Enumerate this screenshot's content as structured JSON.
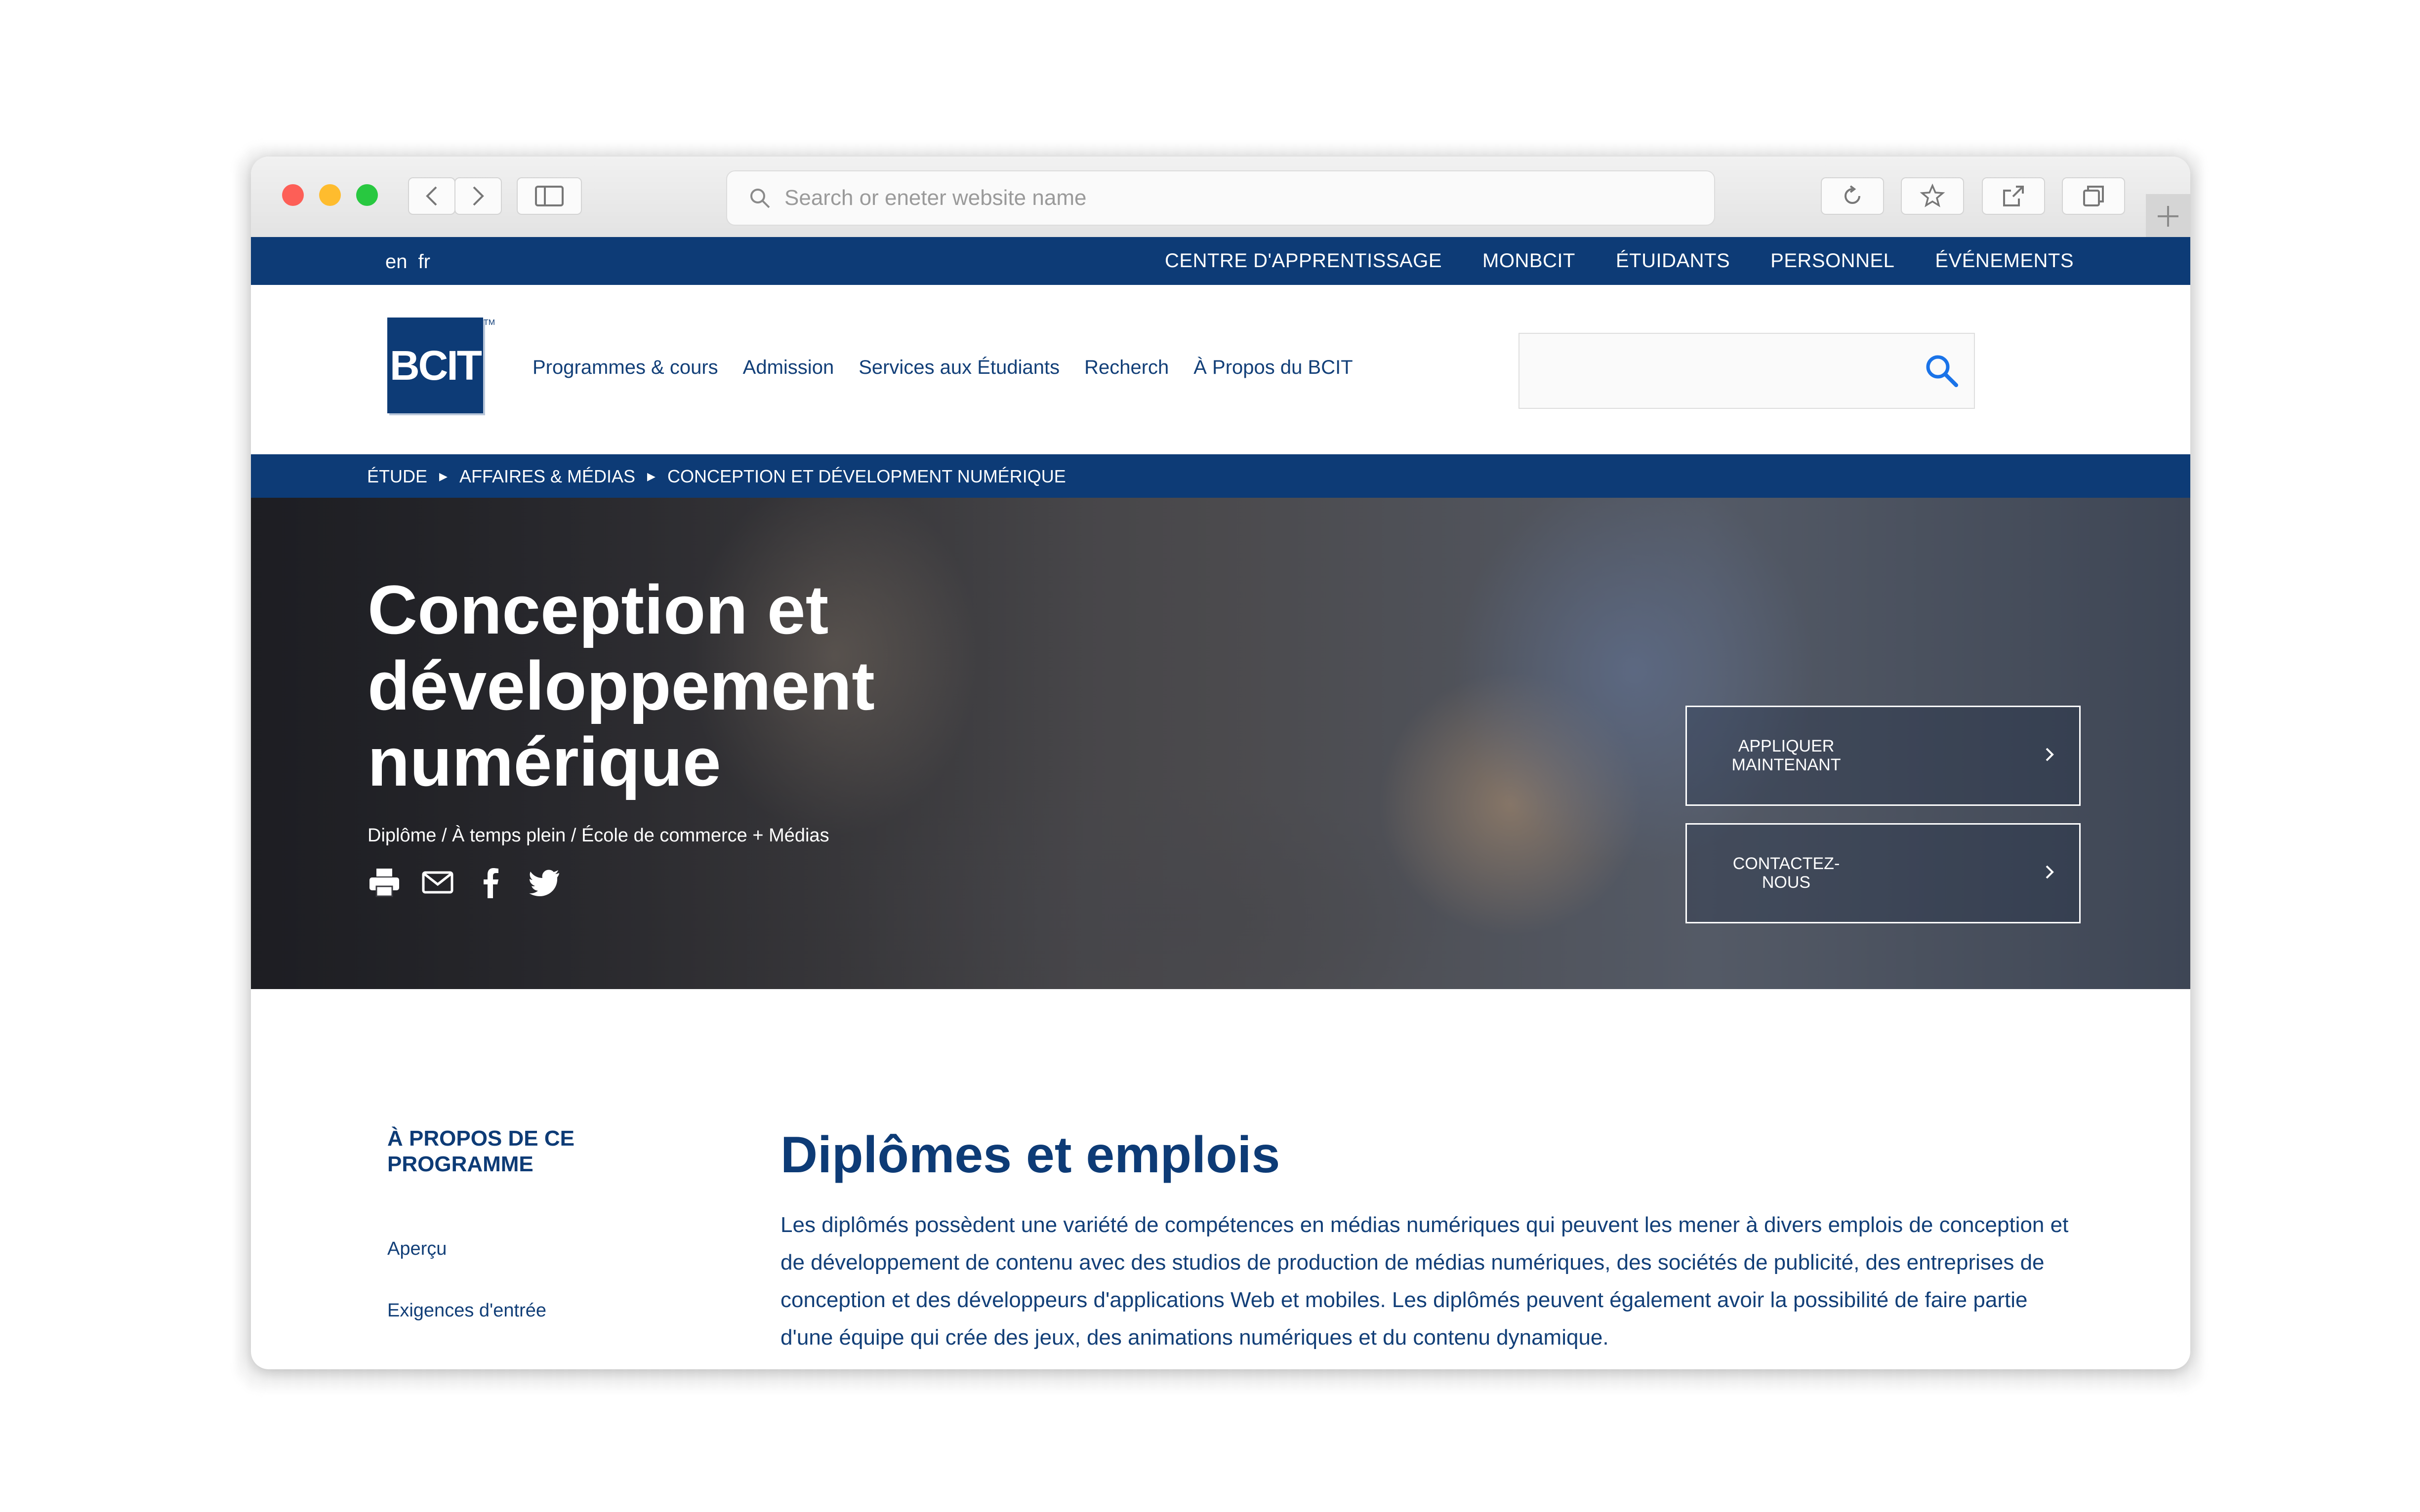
{
  "browser": {
    "url_placeholder": "Search or eneter website name"
  },
  "utility": {
    "languages": [
      "en",
      "fr"
    ],
    "links": [
      "CENTRE D'APPRENTISSAGE",
      "MONBCIT",
      "ÉTUIDANTS",
      "PERSONNEL",
      "ÉVÉNEMENTS"
    ]
  },
  "header": {
    "logo": "BCIT",
    "logo_tm": "TM",
    "nav": [
      "Programmes & cours",
      "Admission",
      "Services aux Étudiants",
      "Recherch",
      "À Propos du BCIT"
    ]
  },
  "breadcrumb": [
    "ÉTUDE",
    "AFFAIRES & MÉDIAS",
    "CONCEPTION ET DÉVELOPMENT NUMÉRIQUE"
  ],
  "hero": {
    "title": "Conception et développement numérique",
    "subtitle": "Diplôme / À temps plein / École de commerce + Médias",
    "apply_label": "APPLIQUER MAINTENANT",
    "contact_label": "CONTACTEZ-NOUS"
  },
  "sidebar": {
    "title": "À PROPOS DE CE PROGRAMME",
    "links": [
      "Aperçu",
      "Exigences d'entrée"
    ]
  },
  "content": {
    "title": "Diplômes et emplois",
    "body": "Les diplômés possèdent une variété de compétences en médias numériques qui peuvent les mener à divers emplois de conception et de développement de contenu avec des studios de production de médias numériques, des sociétés de publicité, des entreprises de conception et des développeurs d'applications Web et mobiles. Les diplômés peuvent également avoir la possibilité de faire partie d'une équipe qui crée des jeux, des animations numériques et du contenu dynamique."
  },
  "colors": {
    "brand_navy": "#0d3b76",
    "link_blue": "#123f78",
    "search_icon_blue": "#1a73e8"
  }
}
